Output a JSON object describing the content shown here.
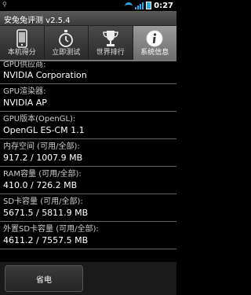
{
  "status_bar": {
    "left_icon": "usb-icon",
    "time": "0:27",
    "accent": "#2fa8e8"
  },
  "app": {
    "title": "安兔兔评测 v2.5.4"
  },
  "tabs": [
    {
      "label": "本机得分",
      "icon": "phone-icon",
      "active": false
    },
    {
      "label": "立即测试",
      "icon": "stopwatch-icon",
      "active": false
    },
    {
      "label": "世界排行",
      "icon": "trophy-icon",
      "active": false
    },
    {
      "label": "系统信息",
      "icon": "info-icon",
      "active": true
    }
  ],
  "info": [
    {
      "label": "GPU供应商:",
      "value": "NVIDIA Corporation"
    },
    {
      "label": "GPU渲染器:",
      "value": "NVIDIA AP"
    },
    {
      "label": "GPU版本(OpenGL):",
      "value": "OpenGL ES-CM 1.1"
    },
    {
      "label": "内存空间 (可用/全部):",
      "value": "917.2 / 1007.9 MB"
    },
    {
      "label": "RAM容量 (可用/全部):",
      "value": "410.0 / 726.2 MB"
    },
    {
      "label": "SD卡容量 (可用/全部):",
      "value": "5671.5 / 5811.9 MB"
    },
    {
      "label": "外置SD卡容量 (可用/全部):",
      "value": "4611.2 / 7557.5 MB"
    }
  ],
  "bottom": {
    "power_button_label": "省电"
  }
}
